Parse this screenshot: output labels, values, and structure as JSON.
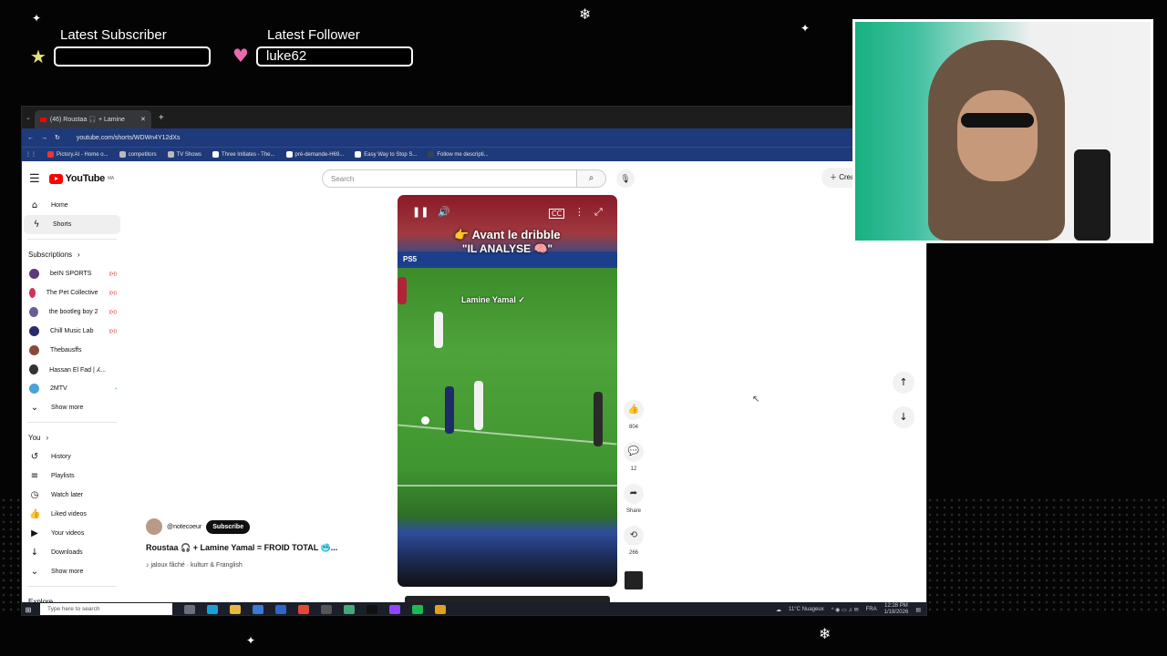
{
  "overlay": {
    "latest_subscriber_label": "Latest Subscriber",
    "latest_subscriber_value": "",
    "latest_follower_label": "Latest Follower",
    "latest_follower_value": "luke62",
    "star_icon": "star-icon",
    "heart_icon": "heart-icon"
  },
  "browser": {
    "tab_title": "(46) Roustaa 🎧 + Lamine",
    "url": "youtube.com/shorts/WDWn4Y12dXs",
    "bookmarks": [
      "Pictory.AI - Home o...",
      "competitors",
      "TV Shows",
      "Three Initiates - The...",
      "pré-demande-H69...",
      "Easy Way to Stop S...",
      "Follow me descripti..."
    ]
  },
  "youtube": {
    "logo_text": "YouTube",
    "region": "MA",
    "search_placeholder": "Search",
    "create_label": "Crea",
    "nav": [
      {
        "icon": "⌂",
        "label": "Home"
      },
      {
        "icon": "ϟ",
        "label": "Shorts"
      }
    ],
    "subscriptions_title": "Subscriptions",
    "subscriptions": [
      {
        "label": "beIN SPORTS",
        "live": "((•))"
      },
      {
        "label": "The Pet Collective",
        "live": "((•))"
      },
      {
        "label": "the bootleg boy 2",
        "live": "((•))"
      },
      {
        "label": "Chill Music Lab",
        "live": "((•))"
      },
      {
        "label": "Thebausffs",
        "live": ""
      },
      {
        "label": "Hassan El Fad | ⵃ...",
        "live": ""
      },
      {
        "label": "2MTV",
        "live": "•"
      }
    ],
    "show_more": "Show more",
    "you_title": "You",
    "you_items": [
      {
        "icon": "↺",
        "label": "History"
      },
      {
        "icon": "≡",
        "label": "Playlists"
      },
      {
        "icon": "◷",
        "label": "Watch later"
      },
      {
        "icon": "👍",
        "label": "Liked videos"
      },
      {
        "icon": "▶",
        "label": "Your videos"
      },
      {
        "icon": "↓",
        "label": "Downloads"
      }
    ],
    "show_more_2": "Show more",
    "explore": "Explore"
  },
  "short": {
    "caption_line1": "👉 Avant le dribble",
    "caption_line2": "\"IL ANALYSE 🧠\"",
    "player_tag": "Lamine Yamal ✓",
    "ad_text": "PS5",
    "channel": "@notecoeur",
    "subscribe": "Subscribe",
    "title": "Roustaa 🎧 + Lamine Yamal = FROID TOTAL 🥶...",
    "music": "jaloux fâché · kulturr & Franglish",
    "likes": "804",
    "comments": "12",
    "share": "Share",
    "remix": "266"
  },
  "taskbar": {
    "search_placeholder": "Type here to search",
    "weather": "11°C Nuageux",
    "lang": "FRA",
    "time": "12:28 PM",
    "date": "1/18/2026"
  }
}
